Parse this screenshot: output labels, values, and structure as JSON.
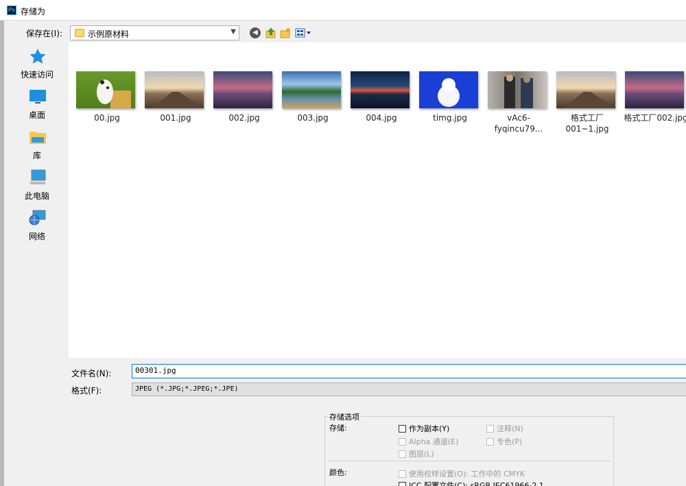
{
  "window": {
    "app_icon": "Ps",
    "title": "存储为"
  },
  "toolbar": {
    "location_label": "保存在(I):",
    "location_value": "示例原材料"
  },
  "places": [
    {
      "label": "快速访问",
      "icon": "star-icon"
    },
    {
      "label": "桌面",
      "icon": "desktop-icon"
    },
    {
      "label": "库",
      "icon": "library-folder-icon"
    },
    {
      "label": "此电脑",
      "icon": "computer-icon"
    },
    {
      "label": "网络",
      "icon": "network-icon"
    }
  ],
  "files": [
    {
      "name": "00.jpg"
    },
    {
      "name": "001.jpg"
    },
    {
      "name": "002.jpg"
    },
    {
      "name": "003.jpg"
    },
    {
      "name": "004.jpg"
    },
    {
      "name": "timg.jpg"
    },
    {
      "name": "vAc6-fyqincu79..."
    },
    {
      "name": "格式工厂",
      "name2": "001~1.jpg"
    },
    {
      "name": "格式工厂002.jpg"
    }
  ],
  "form": {
    "filename_label": "文件名(N):",
    "filename_value": "00301.jpg",
    "format_label": "格式(F):",
    "format_value": "JPEG (*.JPG;*.JPEG;*.JPE)"
  },
  "options": {
    "legend": "存储选项",
    "save_label": "存储:",
    "as_copy": "作为副本(Y)",
    "notes": "注释(N)",
    "alpha": "Alpha 通道(E)",
    "spot": "专色(P)",
    "layers": "图层(L)",
    "color_label": "颜色:",
    "proof": "使用校样设置(O):  工作中的 CMYK",
    "icc": "ICC 配置文件(C):  sRGB IEC61966-2.1"
  }
}
